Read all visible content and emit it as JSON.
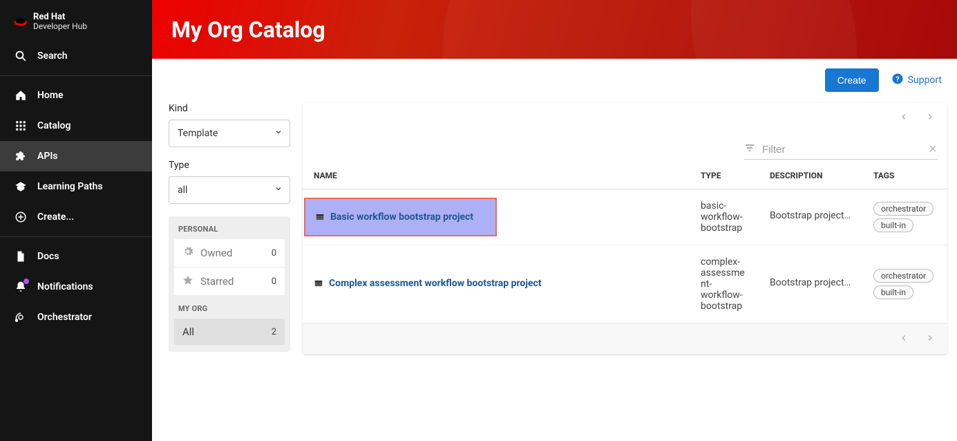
{
  "brand": {
    "top": "Red Hat",
    "sub": "Developer Hub"
  },
  "sidebar": {
    "search": "Search",
    "items": [
      {
        "label": "Home",
        "icon": "home-icon"
      },
      {
        "label": "Catalog",
        "icon": "grid-icon"
      },
      {
        "label": "APIs",
        "icon": "puzzle-icon"
      },
      {
        "label": "Learning Paths",
        "icon": "school-icon"
      },
      {
        "label": "Create...",
        "icon": "plus-circle-icon"
      }
    ],
    "items2": [
      {
        "label": "Docs",
        "icon": "doc-icon"
      },
      {
        "label": "Notifications",
        "icon": "bell-icon"
      },
      {
        "label": "Orchestrator",
        "icon": "orchestrator-icon"
      }
    ]
  },
  "header": {
    "title": "My Org Catalog"
  },
  "actions": {
    "create": "Create",
    "support": "Support"
  },
  "filters": {
    "kind_label": "Kind",
    "kind_value": "Template",
    "type_label": "Type",
    "type_value": "all",
    "personal_header": "PERSONAL",
    "owned_label": "Owned",
    "owned_count": "0",
    "starred_label": "Starred",
    "starred_count": "0",
    "myorg_header": "MY ORG",
    "all_label": "All",
    "all_count": "2"
  },
  "table": {
    "filter_placeholder": "Filter",
    "columns": {
      "name": "NAME",
      "type": "TYPE",
      "description": "DESCRIPTION",
      "tags": "TAGS"
    },
    "rows": [
      {
        "name": "Basic workflow bootstrap project",
        "type": "basic-workflow-bootstrap",
        "description": "Bootstrap project…",
        "tags": [
          "orchestrator",
          "built-in"
        ],
        "highlight": true
      },
      {
        "name": "Complex assessment workflow bootstrap project",
        "type": "complex-assessment-workflow-bootstrap",
        "description": "Bootstrap project…",
        "tags": [
          "orchestrator",
          "built-in"
        ],
        "highlight": false
      }
    ]
  }
}
